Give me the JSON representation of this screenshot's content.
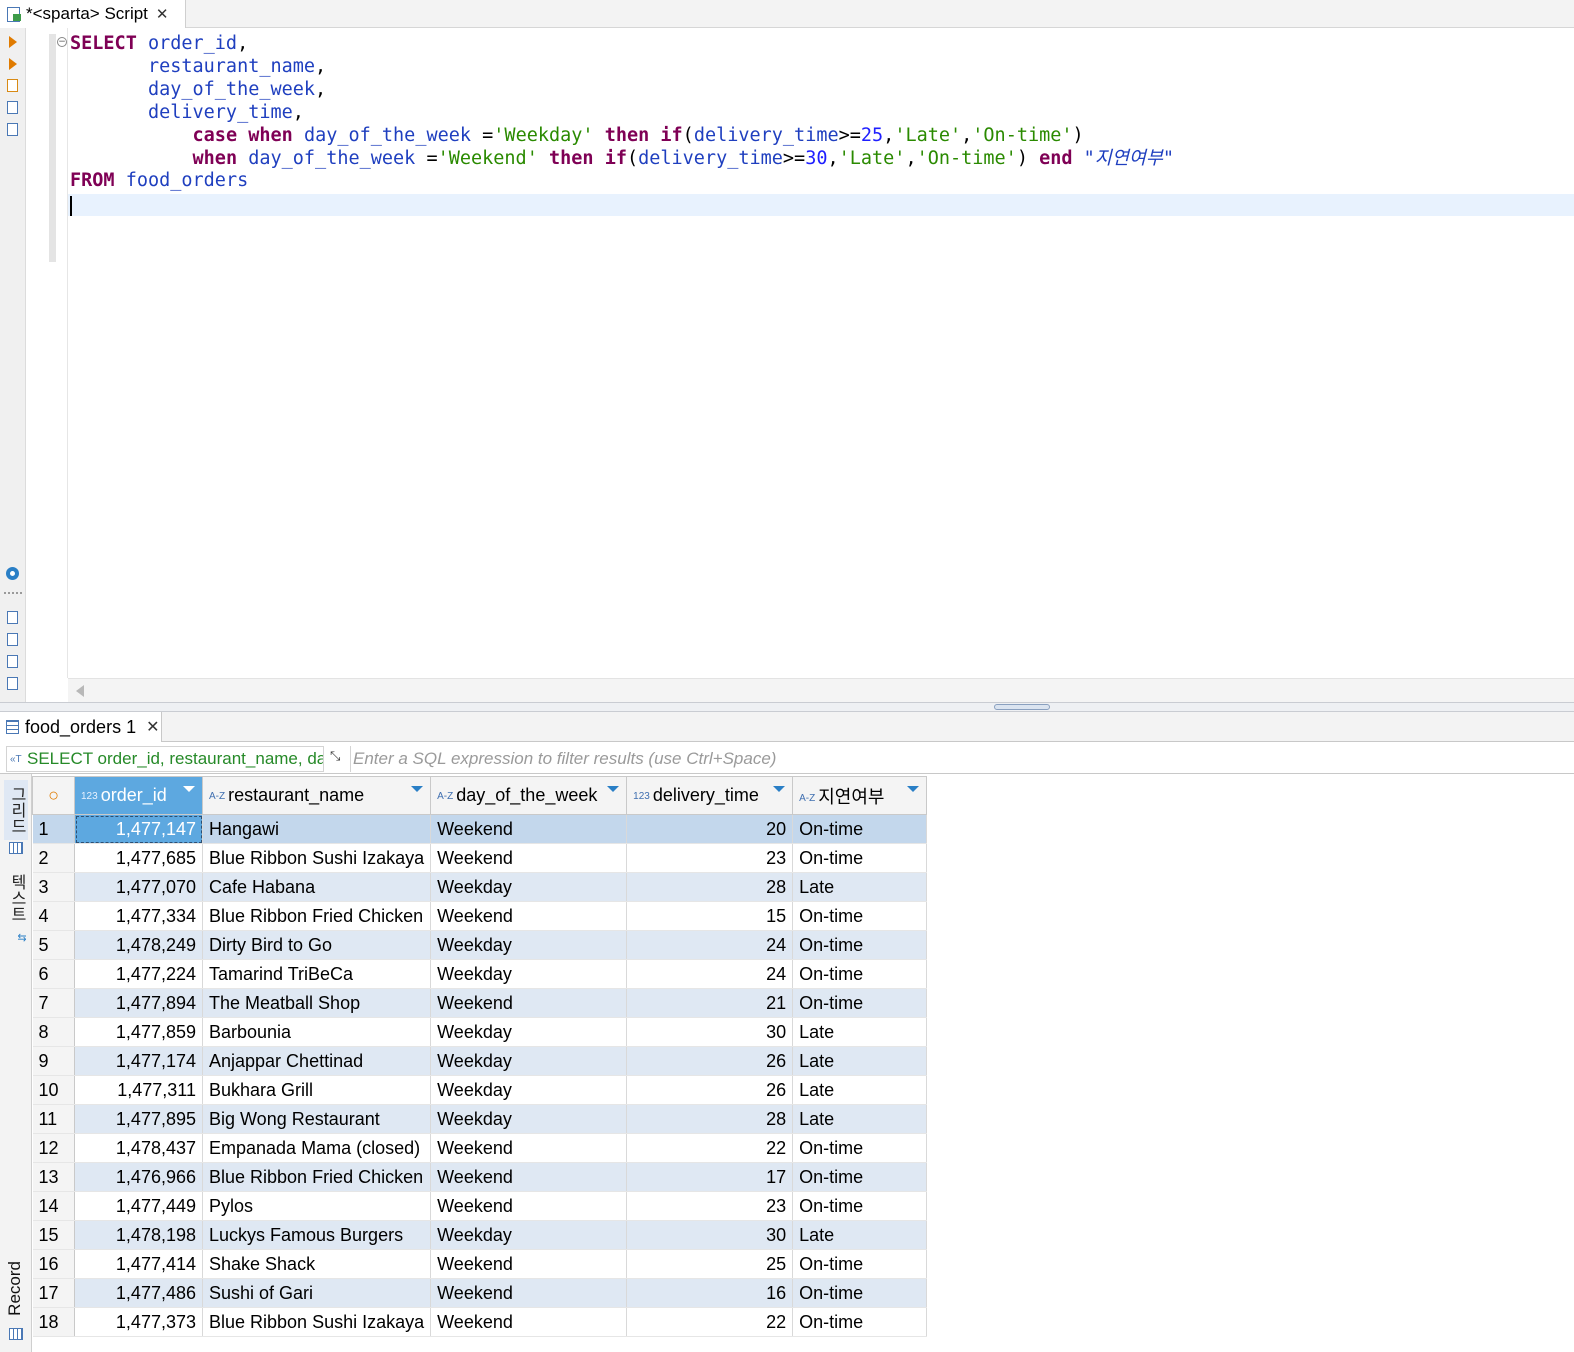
{
  "editor_tab": {
    "title": "*<sparta> Script",
    "close": "✕"
  },
  "editor": {
    "lines": [
      "SELECT order_id,",
      "       restaurant_name,",
      "       day_of_the_week,",
      "       delivery_time,",
      "           case when day_of_the_week ='Weekday' then if(delivery_time>=25,'Late','On-time')",
      "           when day_of_the_week ='Weekend' then if(delivery_time>=30,'Late','On-time') end \"지연여부\"",
      "FROM food_orders"
    ]
  },
  "results_tab": {
    "title": "food_orders 1",
    "close": "✕"
  },
  "filter": {
    "sql_preview": "SELECT order_id, restaurant_name, day_of_the_week, delivery_time, case when",
    "placeholder": "Enter a SQL expression to filter results (use Ctrl+Space)"
  },
  "side_tabs": {
    "grid": "그리드",
    "text": "텍스트",
    "record": "Record"
  },
  "table": {
    "corner": "○",
    "columns": [
      {
        "type": "123",
        "label": "order_id"
      },
      {
        "type": "A-Z",
        "label": "restaurant_name"
      },
      {
        "type": "A-Z",
        "label": "day_of_the_week"
      },
      {
        "type": "123",
        "label": "delivery_time"
      },
      {
        "type": "A-Z",
        "label": "지연여부"
      }
    ],
    "rows": [
      [
        "1",
        "1,477,147",
        "Hangawi",
        "Weekend",
        "20",
        "On-time"
      ],
      [
        "2",
        "1,477,685",
        "Blue Ribbon Sushi Izakaya",
        "Weekend",
        "23",
        "On-time"
      ],
      [
        "3",
        "1,477,070",
        "Cafe Habana",
        "Weekday",
        "28",
        "Late"
      ],
      [
        "4",
        "1,477,334",
        "Blue Ribbon Fried Chicken",
        "Weekend",
        "15",
        "On-time"
      ],
      [
        "5",
        "1,478,249",
        "Dirty Bird to Go",
        "Weekday",
        "24",
        "On-time"
      ],
      [
        "6",
        "1,477,224",
        "Tamarind TriBeCa",
        "Weekday",
        "24",
        "On-time"
      ],
      [
        "7",
        "1,477,894",
        "The Meatball Shop",
        "Weekend",
        "21",
        "On-time"
      ],
      [
        "8",
        "1,477,859",
        "Barbounia",
        "Weekday",
        "30",
        "Late"
      ],
      [
        "9",
        "1,477,174",
        "Anjappar Chettinad",
        "Weekday",
        "26",
        "Late"
      ],
      [
        "10",
        "1,477,311",
        "Bukhara Grill",
        "Weekday",
        "26",
        "Late"
      ],
      [
        "11",
        "1,477,895",
        "Big Wong Restaurant",
        "Weekday",
        "28",
        "Late"
      ],
      [
        "12",
        "1,478,437",
        "Empanada Mama (closed)",
        "Weekend",
        "22",
        "On-time"
      ],
      [
        "13",
        "1,476,966",
        "Blue Ribbon Fried Chicken",
        "Weekend",
        "17",
        "On-time"
      ],
      [
        "14",
        "1,477,449",
        "Pylos",
        "Weekend",
        "23",
        "On-time"
      ],
      [
        "15",
        "1,478,198",
        "Luckys Famous Burgers",
        "Weekday",
        "30",
        "Late"
      ],
      [
        "16",
        "1,477,414",
        "Shake Shack",
        "Weekend",
        "25",
        "On-time"
      ],
      [
        "17",
        "1,477,486",
        "Sushi of Gari",
        "Weekend",
        "16",
        "On-time"
      ],
      [
        "18",
        "1,477,373",
        "Blue Ribbon Sushi Izakaya",
        "Weekend",
        "22",
        "On-time"
      ]
    ]
  }
}
